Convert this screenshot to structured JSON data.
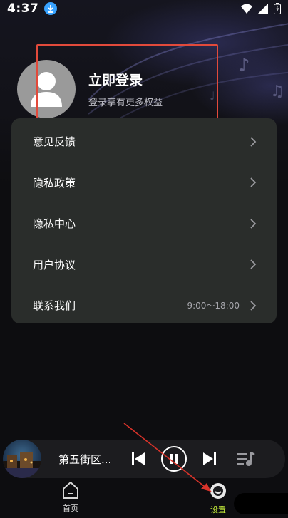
{
  "status_bar": {
    "time": "4:37",
    "icons": [
      "download-icon",
      "wifi-icon",
      "signal-icon",
      "battery-icon"
    ]
  },
  "login": {
    "title": "立即登录",
    "subtitle": "登录享有更多权益",
    "avatar_icon": "user-silhouette-icon"
  },
  "menu": {
    "items": [
      {
        "label": "意见反馈",
        "extra": ""
      },
      {
        "label": "隐私政策",
        "extra": ""
      },
      {
        "label": "隐私中心",
        "extra": ""
      },
      {
        "label": "用户协议",
        "extra": ""
      },
      {
        "label": "联系我们",
        "extra": "9:00～18:00"
      }
    ]
  },
  "player": {
    "song_title": "第五街区...",
    "controls": [
      "previous-icon",
      "pause-icon",
      "next-icon",
      "playlist-icon"
    ]
  },
  "tabbar": {
    "tabs": [
      {
        "label": "首页",
        "icon": "home-icon",
        "active": false
      },
      {
        "label": "设置",
        "icon": "settings-icon",
        "active": true
      }
    ]
  },
  "colors": {
    "background": "#0d0d10",
    "card": "#2a2d2b",
    "accent": "#c7ef3b",
    "highlight_box": "#e24a3b"
  }
}
